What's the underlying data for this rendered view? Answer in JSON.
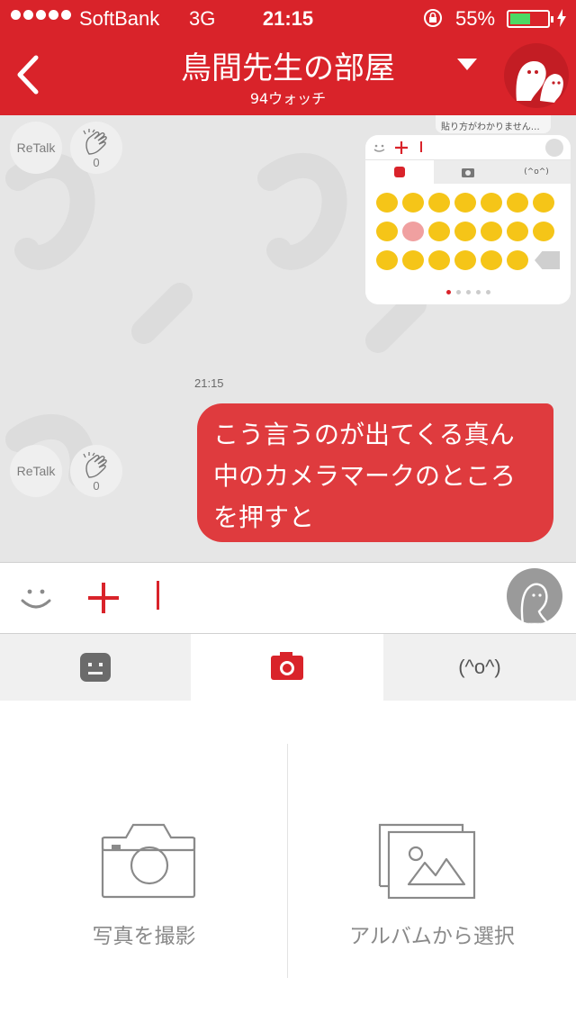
{
  "status_bar": {
    "carrier": "SoftBank",
    "network": "3G",
    "time": "21:15",
    "battery_percent": "55%",
    "battery_level": 0.55
  },
  "nav": {
    "title": "鳥間先生の部屋",
    "subtitle": "94ウォッチ"
  },
  "chat": {
    "messages": [
      {
        "type": "image",
        "caption_top": "貼り方がわかりません…",
        "mini_kaomoji_tab": "(^o^)",
        "retalk_label": "ReTalk",
        "clap_count": "0"
      },
      {
        "type": "text",
        "time": "21:15",
        "text": "こう言うのが出てくる真ん中のカメラマークのところを押すと",
        "retalk_label": "ReTalk",
        "clap_count": "0"
      }
    ]
  },
  "tabs": {
    "kaomoji_label": "(^o^)"
  },
  "panel": {
    "take_photo_label": "写真を撮影",
    "album_label": "アルバムから選択"
  },
  "colors": {
    "brand_red": "#d9232a",
    "bubble_red": "#df3b3e"
  }
}
